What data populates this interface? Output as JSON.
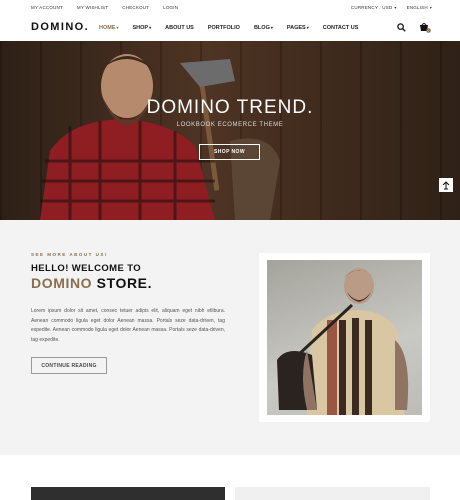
{
  "topbar": {
    "left_links": [
      "MY ACCOUNT",
      "MY WISHLIST",
      "CHECKOUT",
      "LOGIN"
    ],
    "currency": "CURRENCY : USD",
    "language": "ENGLISH"
  },
  "nav": {
    "logo": "DOMINO.",
    "items": [
      {
        "label": "HOME",
        "dropdown": true,
        "active": true
      },
      {
        "label": "SHOP",
        "dropdown": true
      },
      {
        "label": "ABOUT US"
      },
      {
        "label": "PORTFOLIO"
      },
      {
        "label": "BLOG",
        "dropdown": true
      },
      {
        "label": "PAGES",
        "dropdown": true
      },
      {
        "label": "CONTACT US"
      }
    ],
    "cart_count": "0"
  },
  "hero": {
    "title": "DOMINO TREND.",
    "subtitle": "LOOKBOOK ECOMERCE THEME",
    "button": "SHOP NOW"
  },
  "about": {
    "eyebrow": "SEE MORE ABOUT US!",
    "heading": "HELLO! WELCOME TO",
    "brand": "DOMINO",
    "brand_rest": " STORE.",
    "paragraph": "Lorem ipsum dolor sit amet, consec tetuer adipis elit, aliquam eget nibh etlibura. Aenean commodo ligula eget dolor Aenean massa. Portals seze data-driven, tag expedite. Aenean commodo ligula eget dolor Aenean massa. Portals seze data-driven, tag expedite.",
    "button": "CONTINUE READING"
  },
  "colors": {
    "accent": "#8a6d4e",
    "dark": "#111111",
    "section_bg": "#f3f3f3"
  },
  "icons": [
    "search-icon",
    "cart-icon",
    "caret-down-icon",
    "scroll-top-icon"
  ]
}
